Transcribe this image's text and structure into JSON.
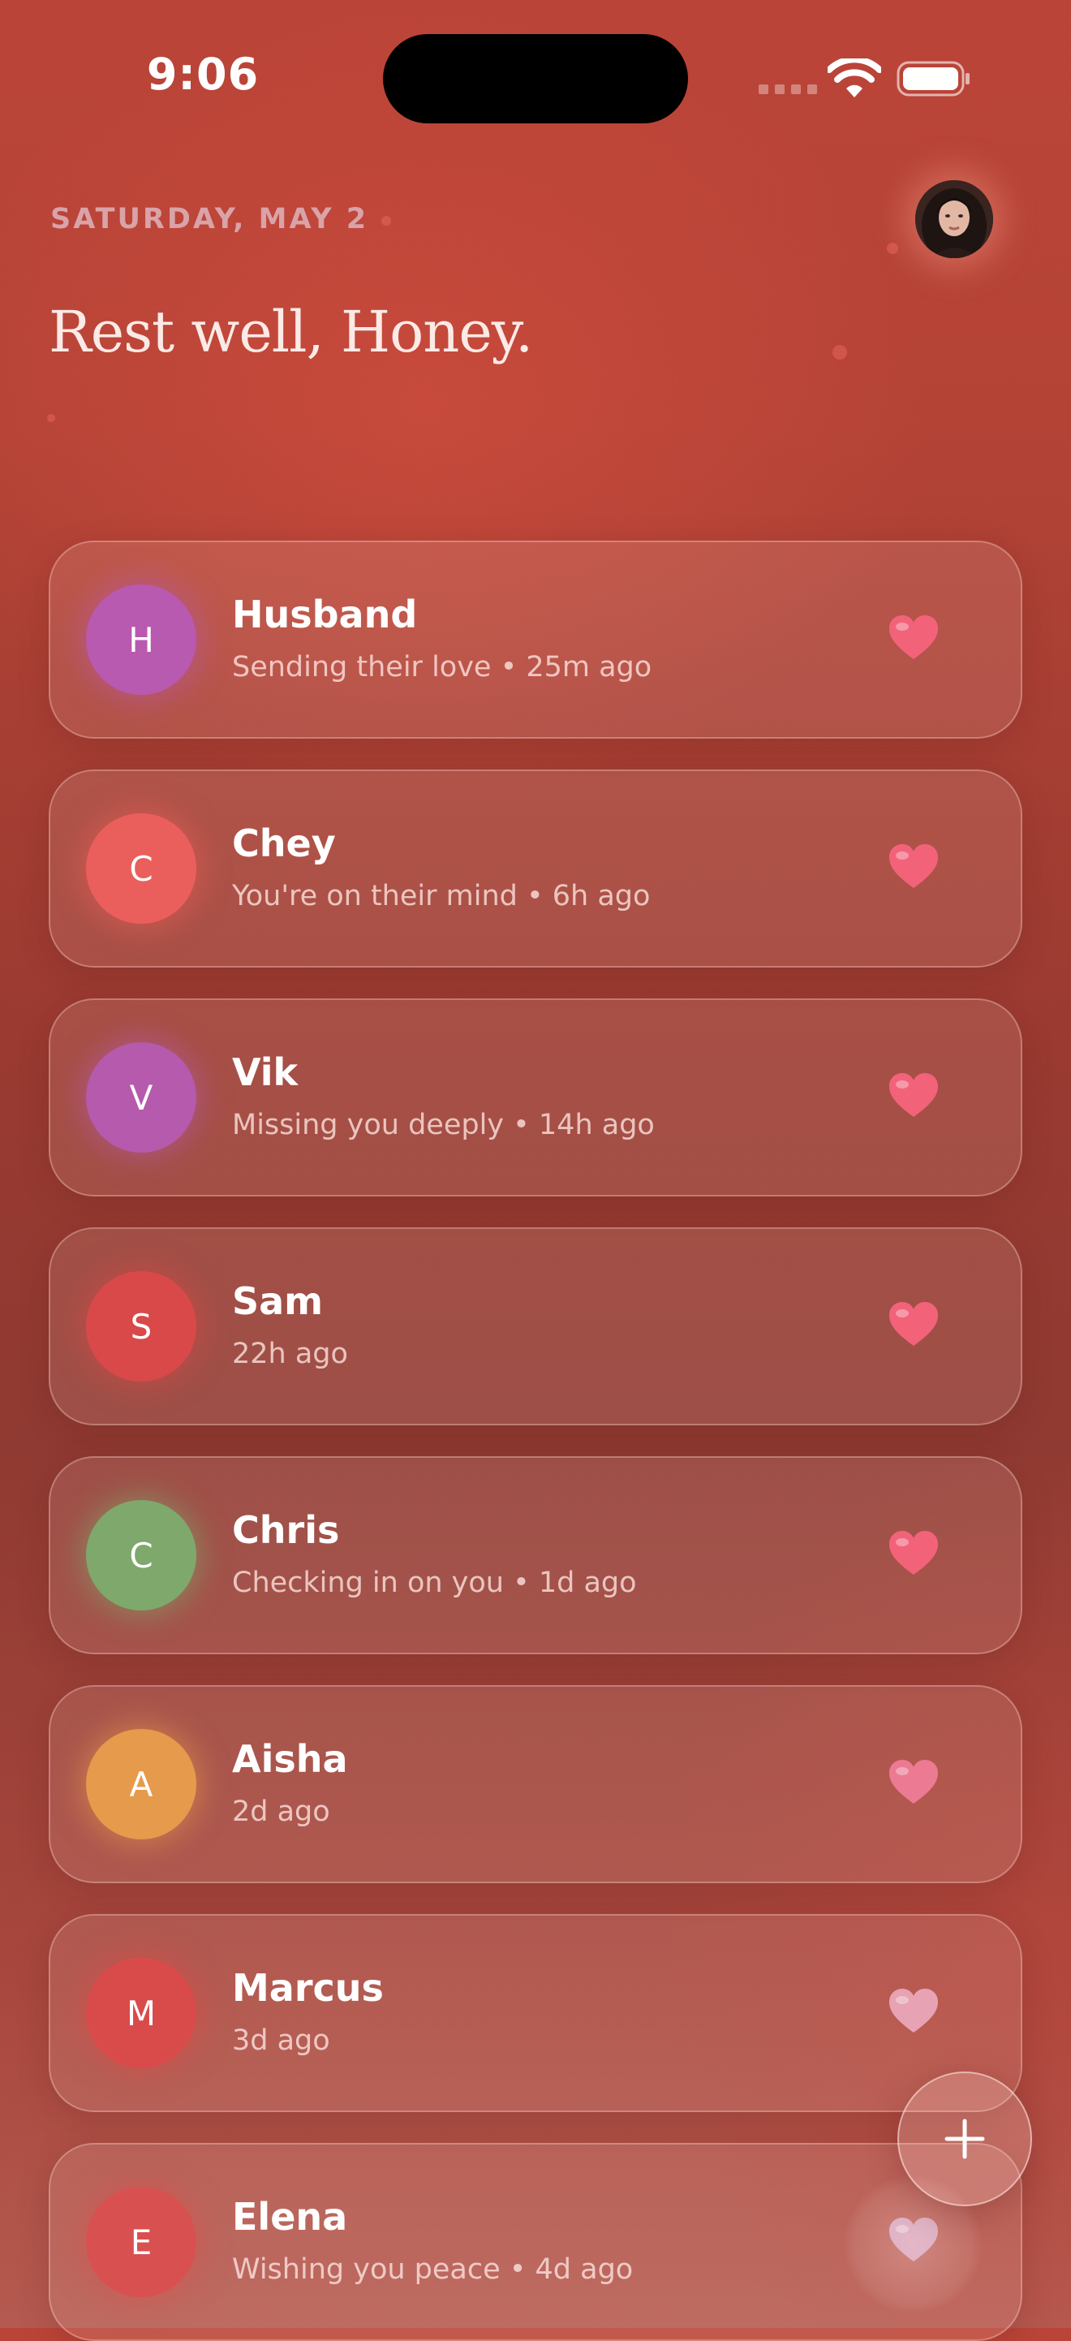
{
  "status_bar": {
    "time": "9:06",
    "icons": [
      "cellular-icon",
      "wifi-icon",
      "battery-icon"
    ]
  },
  "header": {
    "date": "SATURDAY, MAY 2",
    "greeting": "Rest well, Honey.",
    "avatar_icon": "profile-avatar"
  },
  "contacts": [
    {
      "initial": "H",
      "name": "Husband",
      "status": "Sending their love • 25m ago",
      "color": "#b85ab0"
    },
    {
      "initial": "C",
      "name": "Chey",
      "status": "You're on their mind • 6h ago",
      "color": "#ea5f5c"
    },
    {
      "initial": "V",
      "name": "Vik",
      "status": "Missing you deeply • 14h ago",
      "color": "#b55aac"
    },
    {
      "initial": "S",
      "name": "Sam",
      "status": "22h ago",
      "color": "#d9494a"
    },
    {
      "initial": "C",
      "name": "Chris",
      "status": "Checking in on you • 1d ago",
      "color": "#7fa86c"
    },
    {
      "initial": "A",
      "name": "Aisha",
      "status": "2d ago",
      "color": "#e69a4c"
    },
    {
      "initial": "M",
      "name": "Marcus",
      "status": "3d ago",
      "color": "#d94b4b"
    },
    {
      "initial": "E",
      "name": "Elena",
      "status": "Wishing you peace • 4d ago",
      "color": "#d95050"
    }
  ],
  "heart_icon": "heart-icon",
  "fab": {
    "icon": "plus-icon"
  },
  "colors": {
    "heart": "#f2637a",
    "heart_faded": "#e7a3b3",
    "accent_text": "#d9a3a8"
  }
}
